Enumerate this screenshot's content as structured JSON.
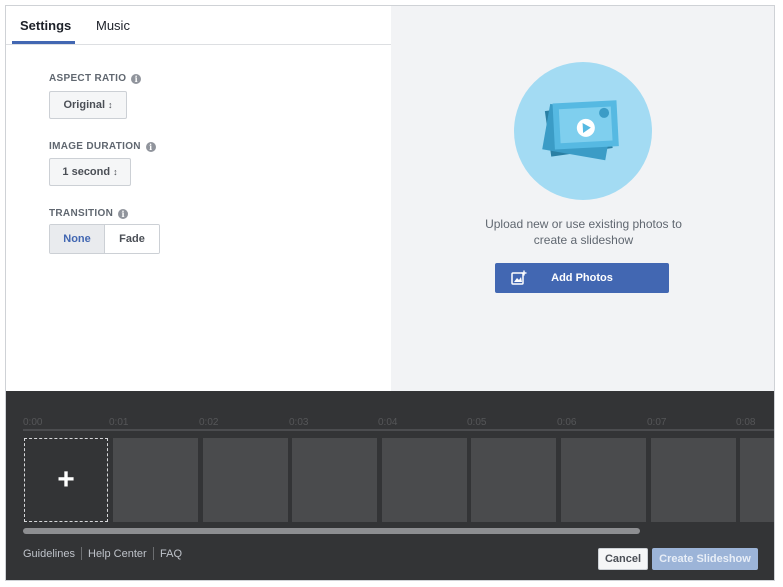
{
  "tabs": [
    {
      "label": "Settings",
      "active": true
    },
    {
      "label": "Music",
      "active": false
    }
  ],
  "settings": {
    "aspect_ratio": {
      "label": "ASPECT RATIO",
      "value": "Original"
    },
    "image_duration": {
      "label": "IMAGE DURATION",
      "value": "1 second"
    },
    "transition": {
      "label": "TRANSITION",
      "options": [
        "None",
        "Fade"
      ],
      "selected": "None"
    }
  },
  "upload": {
    "text_line1": "Upload new or use existing photos to",
    "text_line2": "create a slideshow",
    "button_label": "Add Photos"
  },
  "timeline": {
    "time_labels": [
      "0:00",
      "0:01",
      "0:02",
      "0:03",
      "0:04",
      "0:05",
      "0:06",
      "0:07",
      "0:08"
    ],
    "add_symbol": "+",
    "scroll_fraction": 0.82
  },
  "footer": {
    "links": [
      "Guidelines",
      "Help Center",
      "FAQ"
    ],
    "cancel_label": "Cancel",
    "create_label": "Create Slideshow"
  },
  "colors": {
    "accent": "#4267b2",
    "hero_circle": "#a3dbf3",
    "timeline_bg": "#333436",
    "create_disabled": "#9cb4d8"
  },
  "icons": {
    "info": "info-circle-icon",
    "caret": "sort-caret-icon",
    "add_photo": "add-photo-icon",
    "hero": "photo-stack-icon"
  }
}
